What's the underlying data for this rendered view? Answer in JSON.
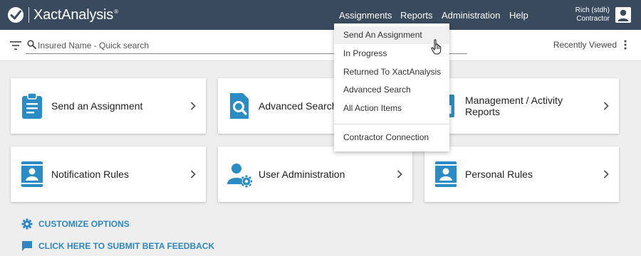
{
  "brand": {
    "name": "XactAnalysis",
    "mark": "®"
  },
  "nav": {
    "items": [
      "Assignments",
      "Reports",
      "Administration",
      "Help"
    ]
  },
  "user": {
    "name": "Rich (stdh)",
    "role": "Contractor"
  },
  "search": {
    "placeholder": "Insured Name - Quick search",
    "value": "",
    "recent_label": "Recently Viewed"
  },
  "cards": [
    {
      "label": "Send an Assignment",
      "icon": "clipboard-icon"
    },
    {
      "label": "Advanced Search",
      "icon": "document-search-icon"
    },
    {
      "label": "Management / Activity Reports",
      "icon": "reports-icon"
    },
    {
      "label": "Notification Rules",
      "icon": "id-card-icon"
    },
    {
      "label": "User Administration",
      "icon": "user-gear-icon"
    },
    {
      "label": "Personal Rules",
      "icon": "id-card-icon"
    }
  ],
  "options": {
    "customize": "CUSTOMIZE OPTIONS",
    "feedback": "CLICK HERE TO SUBMIT BETA FEEDBACK"
  },
  "dropdown": {
    "items": [
      "Send An Assignment",
      "In Progress",
      "Returned To XactAnalysis",
      "Advanced Search",
      "All Action Items",
      "Contractor Connection"
    ],
    "active_index": 0
  },
  "colors": {
    "topbar": "#3a4a5e",
    "accent": "#2b8cc4",
    "link": "#2f86c1",
    "background": "#eeeeee"
  }
}
